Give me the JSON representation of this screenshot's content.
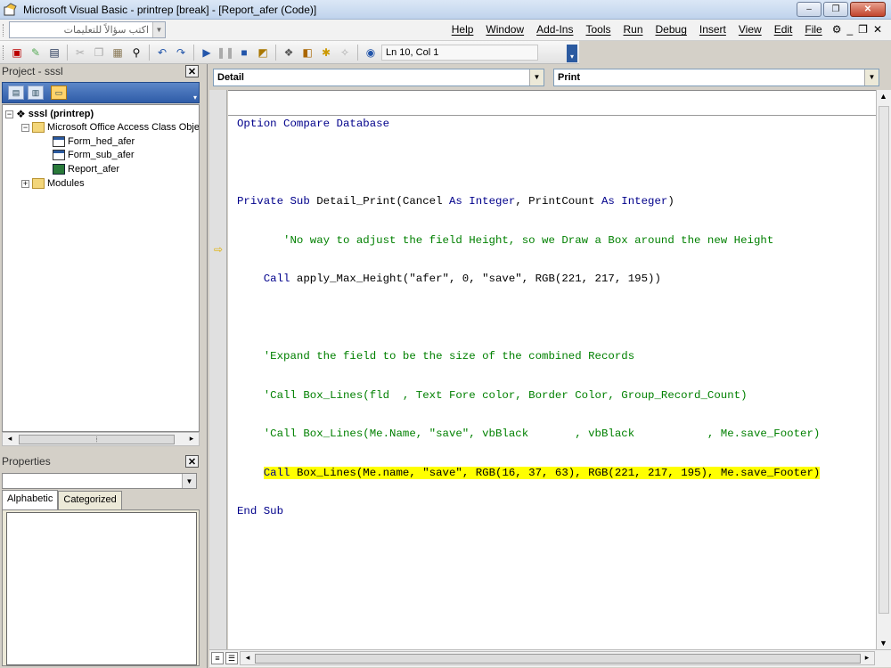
{
  "window": {
    "title": "Microsoft Visual Basic - printrep [break] - [Report_afer (Code)]",
    "buttons": {
      "minimize": "–",
      "restore": "❐",
      "close": "✕"
    }
  },
  "menubar": {
    "ask_placeholder": "اكتب سؤالاً للتعليمات",
    "items": [
      "Help",
      "Window",
      "Add-Ins",
      "Tools",
      "Run",
      "Debug",
      "Insert",
      "View",
      "Edit",
      "File"
    ],
    "mdi_buttons": [
      "_",
      "❐",
      "✕"
    ]
  },
  "toolbar": {
    "position_label": "Ln 10, Col 1"
  },
  "project": {
    "title": "Project - sssl",
    "tree": {
      "root": "sssl (printrep)",
      "folder": "Microsoft Office Access Class Objects",
      "items": [
        "Form_hed_afer",
        "Form_sub_afer",
        "Report_afer"
      ],
      "modules": "Modules"
    }
  },
  "properties": {
    "title": "Properties",
    "tabs": [
      "Alphabetic",
      "Categorized"
    ]
  },
  "code": {
    "object_combo": "Detail",
    "procedure_combo": "Print",
    "lines": {
      "l1": "Option Compare Database",
      "l2a": "Private Sub ",
      "l2b": "Detail_Print(Cancel ",
      "l2c": "As Integer",
      "l2d": ", PrintCount ",
      "l2e": "As Integer",
      "l2f": ")",
      "l3": "       'No way to adjust the field Height, so we Draw a Box around the new Height",
      "l4a": "    Call ",
      "l4b": "apply_Max_Height(\"afer\", 0, \"save\", RGB(221, 217, 195))",
      "l6": "    'Expand the field to be the size of the combined Records",
      "l7": "    'Call Box_Lines(fld  , Text Fore color, Border Color, Group_Record_Count)",
      "l8": "    'Call Box_Lines(Me.Name, \"save\", vbBlack       , vbBlack           , Me.save_Footer)",
      "l9a": "Call ",
      "l9b": "Box_Lines(Me.name, \"save\", RGB(16, 37, 63), RGB(221, 217, 195), Me.save_Footer)",
      "l10": "End Sub"
    }
  },
  "colors": {
    "keyword": "#00008b",
    "comment": "#008000",
    "highlight": "#ffff00"
  }
}
